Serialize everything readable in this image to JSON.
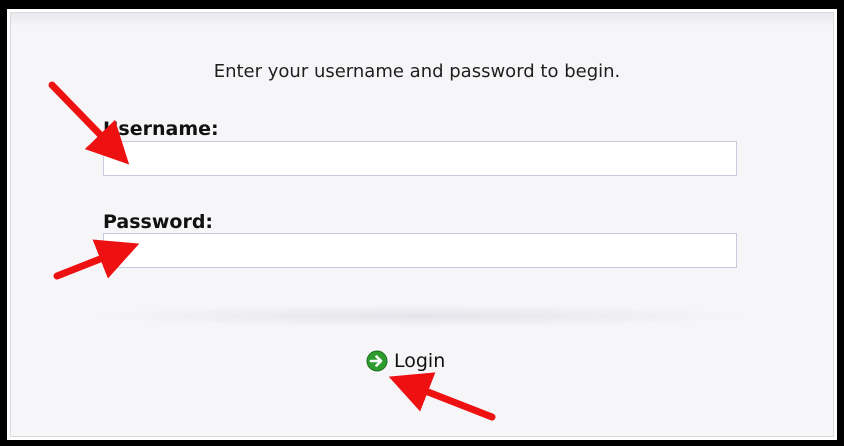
{
  "login_form": {
    "intro_text": "Enter your username and password to begin.",
    "username_label": "Username:",
    "username_value": "",
    "password_label": "Password:",
    "password_value": "",
    "login_button_label": "Login",
    "login_icon": "arrow-right-circle-icon",
    "login_icon_color": "#2e9b2e"
  },
  "annotations": {
    "arrow_color": "#ee1111",
    "arrow_count": 3
  },
  "colors": {
    "frame": "#000000",
    "panel_background": "#f6f6f9",
    "input_border": "#c7c9dc"
  }
}
